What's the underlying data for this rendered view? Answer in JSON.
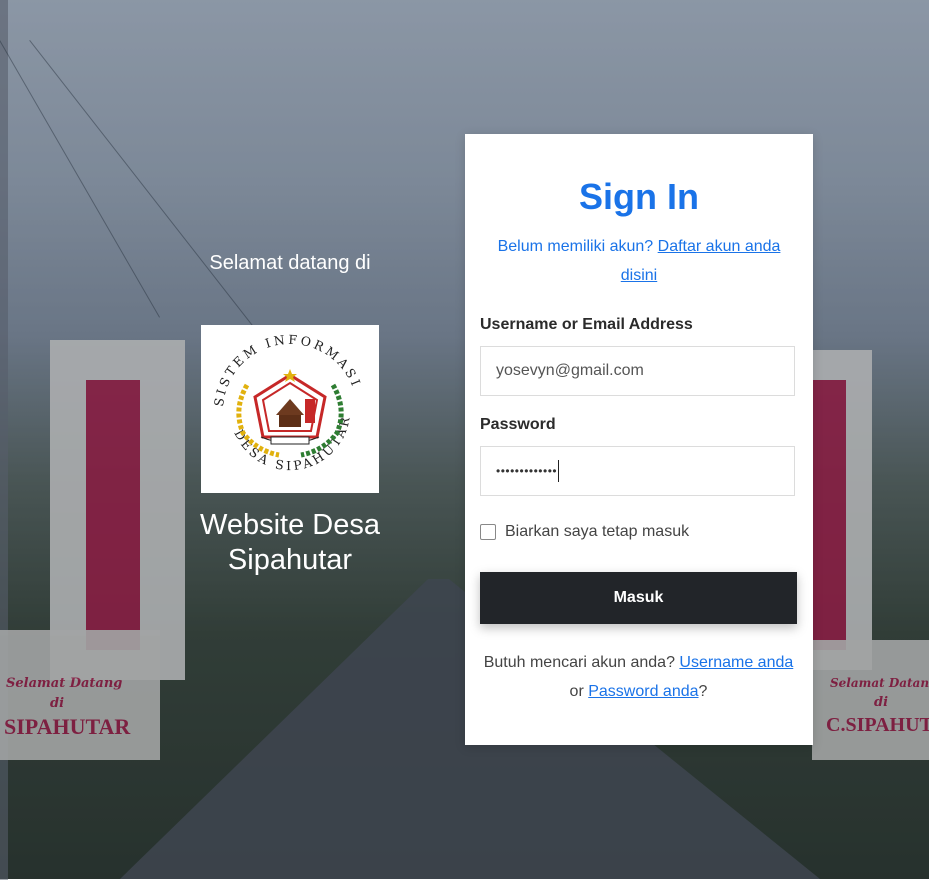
{
  "welcome": {
    "greeting": "Selamat datang di",
    "logo_text_top": "SISTEM INFORMASI",
    "logo_text_bottom": "DESA SIPAHUTAR",
    "site_name_line1": "Website Desa",
    "site_name_line2": "Sipahutar"
  },
  "background": {
    "sign_left_line1": "Selamat Datang",
    "sign_left_line2": "di",
    "sign_left_line3": "SIPAHUTAR",
    "sign_right_line1": "Selamat Datang",
    "sign_right_line2": "di",
    "sign_right_line3": "C.SIPAHUT"
  },
  "form": {
    "title": "Sign In",
    "register_prompt": "Belum memiliki akun?",
    "register_link": "Daftar akun anda disini",
    "username_label": "Username or Email Address",
    "username_value": "yosevyn@gmail.com",
    "password_label": "Password",
    "password_value": "•••••••••••••",
    "remember_label": "Biarkan saya tetap masuk",
    "submit_label": "Masuk",
    "forgot_prompt": "Butuh mencari akun anda?",
    "forgot_username_link": "Username anda",
    "forgot_or": "or",
    "forgot_password_link": "Password anda",
    "forgot_suffix": "?"
  },
  "colors": {
    "accent": "#1a73e8",
    "button": "#222529"
  }
}
